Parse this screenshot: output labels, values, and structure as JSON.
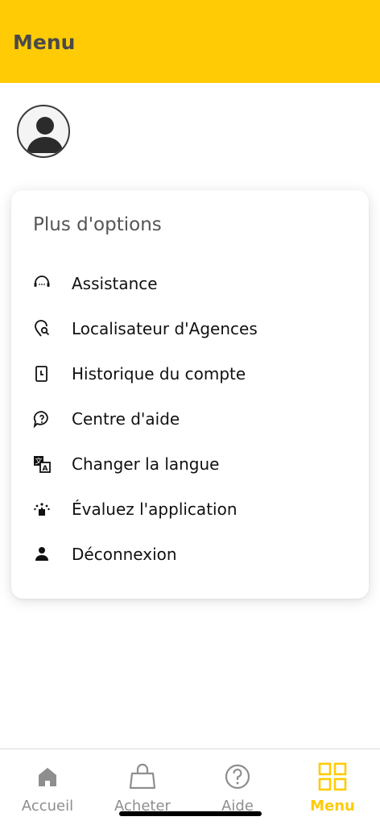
{
  "header": {
    "title": "Menu"
  },
  "avatar": {
    "icon": "person-icon"
  },
  "options_card": {
    "title": "Plus d'options",
    "items": [
      {
        "label": "Assistance",
        "icon": "headset-icon"
      },
      {
        "label": "Localisateur d'Agences",
        "icon": "location-search-icon"
      },
      {
        "label": "Historique du compte",
        "icon": "document-history-icon"
      },
      {
        "label": "Centre d'aide",
        "icon": "help-bubble-icon"
      },
      {
        "label": "Changer la langue",
        "icon": "translate-icon"
      },
      {
        "label": "Évaluez l'application",
        "icon": "rating-icon"
      },
      {
        "label": "Déconnexion",
        "icon": "person-logout-icon"
      }
    ]
  },
  "tabbar": {
    "tabs": [
      {
        "label": "Accueil",
        "icon": "home-icon",
        "active": false
      },
      {
        "label": "Acheter",
        "icon": "shopping-bag-icon",
        "active": false
      },
      {
        "label": "Aide",
        "icon": "help-circle-icon",
        "active": false
      },
      {
        "label": "Menu",
        "icon": "grid-icon",
        "active": true
      }
    ]
  },
  "colors": {
    "brand": "#FFCB05",
    "inactive": "#8e8e8e",
    "text": "#111111"
  }
}
